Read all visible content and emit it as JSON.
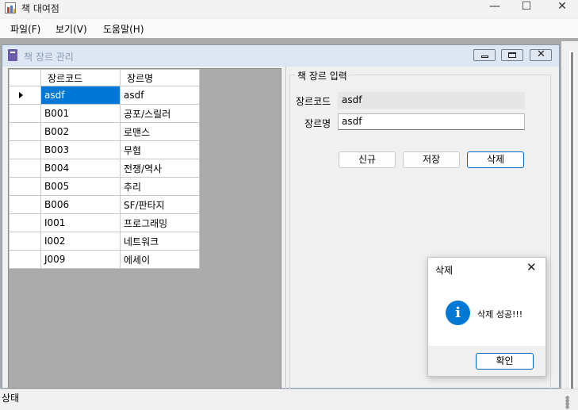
{
  "app": {
    "title": "책 대여점",
    "menu": [
      "파일(F)",
      "보기(V)",
      "도움말(H)"
    ]
  },
  "child_window": {
    "title": "책 장르 관리",
    "grid": {
      "columns": [
        "장르코드",
        "장르명"
      ],
      "selected_row": 0,
      "rows": [
        {
          "code": "asdf",
          "name": "asdf"
        },
        {
          "code": "B001",
          "name": "공포/스릴러"
        },
        {
          "code": "B002",
          "name": "로맨스"
        },
        {
          "code": "B003",
          "name": "무협"
        },
        {
          "code": "B004",
          "name": "전쟁/역사"
        },
        {
          "code": "B005",
          "name": "추리"
        },
        {
          "code": "B006",
          "name": "SF/판타지"
        },
        {
          "code": "I001",
          "name": "프로그래밍"
        },
        {
          "code": "I002",
          "name": "네트워크"
        },
        {
          "code": "J009",
          "name": "에세이"
        }
      ]
    },
    "form": {
      "group_label": "책 장르 입력",
      "code_label": "장르코드",
      "code_value": "asdf",
      "name_label": "장르명",
      "name_value": "asdf",
      "btn_new": "신규",
      "btn_save": "저장",
      "btn_delete": "삭제"
    }
  },
  "status": {
    "text": "상태"
  },
  "dialog": {
    "title": "삭제",
    "message": "삭제 성공!!!",
    "ok": "확인",
    "icon": "info-icon"
  },
  "colors": {
    "selection": "#0078d7",
    "accent": "#0067c0",
    "info": "#0078d4"
  }
}
